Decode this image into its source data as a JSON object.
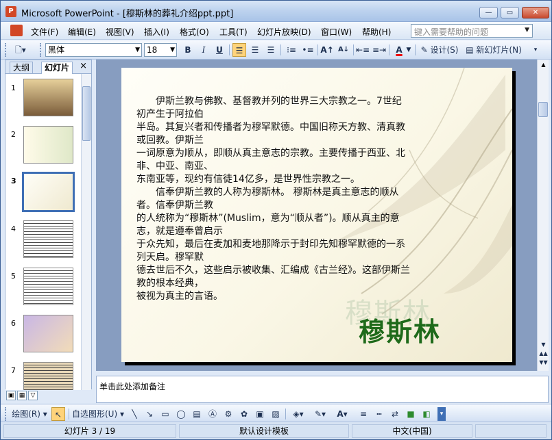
{
  "window": {
    "title": "Microsoft PowerPoint - [穆斯林的葬礼介绍ppt.ppt]",
    "app_icon": "powerpoint-icon"
  },
  "menubar": {
    "items": [
      "文件(F)",
      "编辑(E)",
      "视图(V)",
      "插入(I)",
      "格式(O)",
      "工具(T)",
      "幻灯片放映(D)",
      "窗口(W)",
      "帮助(H)"
    ],
    "help_placeholder": "键入需要帮助的问题"
  },
  "toolbar": {
    "font_name": "黑体",
    "font_size": "18",
    "bold": "B",
    "italic": "I",
    "underline": "U",
    "font_color_label": "A",
    "design_label": "设计(S)",
    "new_slide_label": "新幻灯片(N)"
  },
  "panel": {
    "tabs": [
      "大纲",
      "幻灯片"
    ],
    "close": "×",
    "slide_numbers": [
      "1",
      "2",
      "3",
      "4",
      "5",
      "6",
      "7"
    ],
    "selected": 3
  },
  "slide": {
    "body_lines": [
      "　　伊斯兰教与佛教、基督教并列的世界三大宗教之一。7世纪初产生于阿拉伯",
      "半岛。其复兴者和传播者为穆罕默德。中国旧称天方教、清真教或回教。伊斯兰",
      "一词原意为顺从，即顺从真主意志的宗教。主要传播于西亚、北非、中亚、南亚、",
      "东南亚等，现约有信徒14亿多，是世界性宗教之一。",
      "　　信奉伊斯兰教的人称为穆斯林。 穆斯林是真主意志的顺从者。信奉伊斯兰教",
      "的人统称为“穆斯林”(Muslim，意为“顺从者”)。顺从真主的意志，就是遵奉曾启示",
      "于众先知，最后在麦加和麦地那降示于封印先知穆罕默德的一系列天启。穆罕默",
      "德去世后不久，这些启示被收集、汇编成《古兰经》。这部伊斯兰教的根本经典，",
      "被视为真主的言语。"
    ],
    "watermark": "穆斯林",
    "title": "穆斯林"
  },
  "notes": {
    "placeholder": "单击此处添加备注"
  },
  "drawbar": {
    "draw_label": "绘图(R)",
    "autoshape_label": "自选图形(U)"
  },
  "status": {
    "slide_info": "幻灯片 3 / 19",
    "template": "默认设计模板",
    "language": "中文(中国)"
  },
  "colors": {
    "accent": "#3f6fb5",
    "title_green": "#1e6a1a",
    "ppt_orange": "#d24726"
  }
}
